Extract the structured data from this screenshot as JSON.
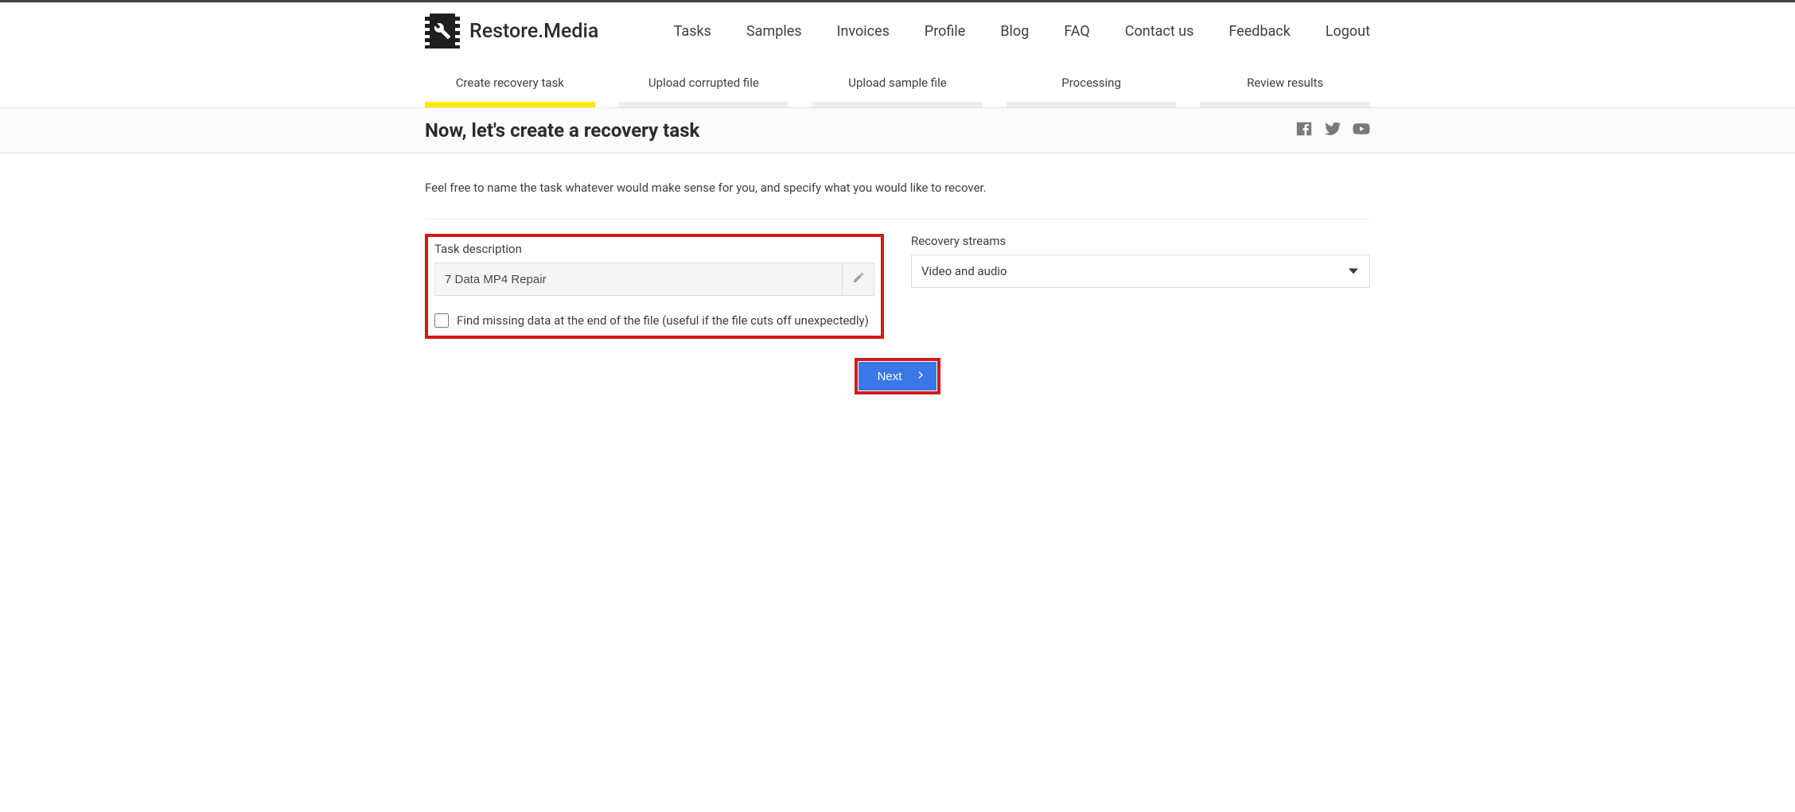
{
  "brand": {
    "name": "Restore.Media"
  },
  "nav": {
    "tasks": "Tasks",
    "samples": "Samples",
    "invoices": "Invoices",
    "profile": "Profile",
    "blog": "Blog",
    "faq": "FAQ",
    "contact": "Contact us",
    "feedback": "Feedback",
    "logout": "Logout"
  },
  "steps": {
    "create": "Create recovery task",
    "upload_corrupted": "Upload corrupted file",
    "upload_sample": "Upload sample file",
    "processing": "Processing",
    "review": "Review results"
  },
  "page": {
    "title": "Now, let's create a recovery task",
    "intro": "Feel free to name the task whatever would make sense for you, and specify what you would like to recover."
  },
  "form": {
    "task_description_label": "Task description",
    "task_description_value": "7 Data MP4 Repair",
    "find_missing_label": "Find missing data at the end of the file (useful if the file cuts off unexpectedly)",
    "recovery_streams_label": "Recovery streams",
    "recovery_streams_value": "Video and audio"
  },
  "buttons": {
    "next": "Next"
  }
}
